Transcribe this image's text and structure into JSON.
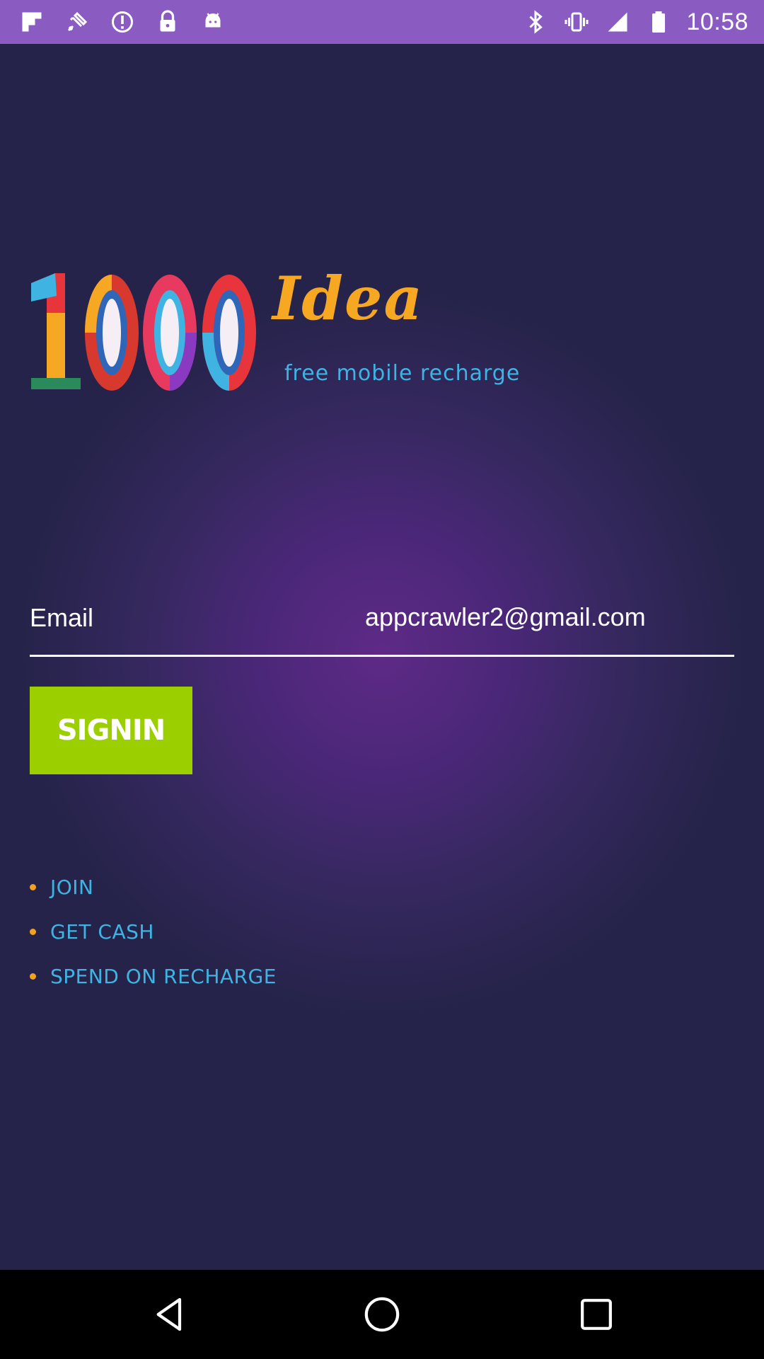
{
  "status_bar": {
    "time": "10:58",
    "left_icons": [
      "flipboard-icon",
      "fake-gps-icon",
      "info-circle-icon",
      "lock-icon",
      "android-icon"
    ],
    "right_icons": [
      "bluetooth-icon",
      "vibrate-icon",
      "signal-icon",
      "battery-icon"
    ],
    "background_color": "#8a5bc1"
  },
  "logo": {
    "digits": "1000",
    "word": "Idea",
    "tagline": "free mobile recharge"
  },
  "login": {
    "email_label": "Email",
    "email_value": "appcrawler2@gmail.com",
    "signin_label": "SIGNIN"
  },
  "features": [
    {
      "label": "JOIN"
    },
    {
      "label": "GET CASH"
    },
    {
      "label": "SPEND ON RECHARGE"
    }
  ],
  "colors": {
    "background": "#252349",
    "accent_green": "#9ccf00",
    "accent_blue": "#3fb4e3",
    "accent_orange": "#f7a823"
  },
  "nav_bar": {
    "buttons": [
      "back-icon",
      "home-icon",
      "recents-icon"
    ]
  }
}
